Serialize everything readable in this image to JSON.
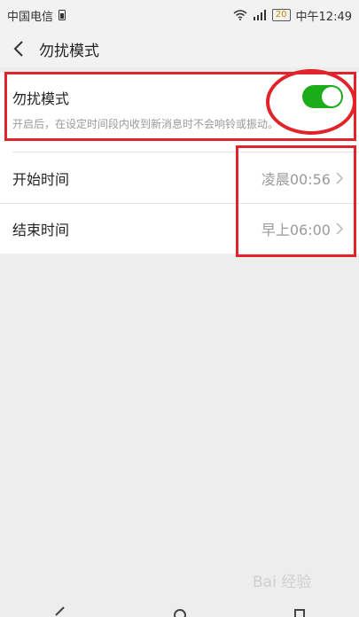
{
  "status_bar": {
    "carrier": "中国电信",
    "battery_level": "20",
    "time": "中午12:49"
  },
  "title_bar": {
    "title": "勿扰模式"
  },
  "dnd_card": {
    "title": "勿扰模式",
    "description": "开启后，在设定时间段内收到新消息时不会响铃或振动。",
    "toggle_on": true,
    "toggle_color": "#1aad19"
  },
  "rows": [
    {
      "label": "开始时间",
      "value": "凌晨00:56"
    },
    {
      "label": "结束时间",
      "value": "早上06:00"
    }
  ],
  "annotation_color": "#e0242a",
  "watermark": "Bai 经验"
}
